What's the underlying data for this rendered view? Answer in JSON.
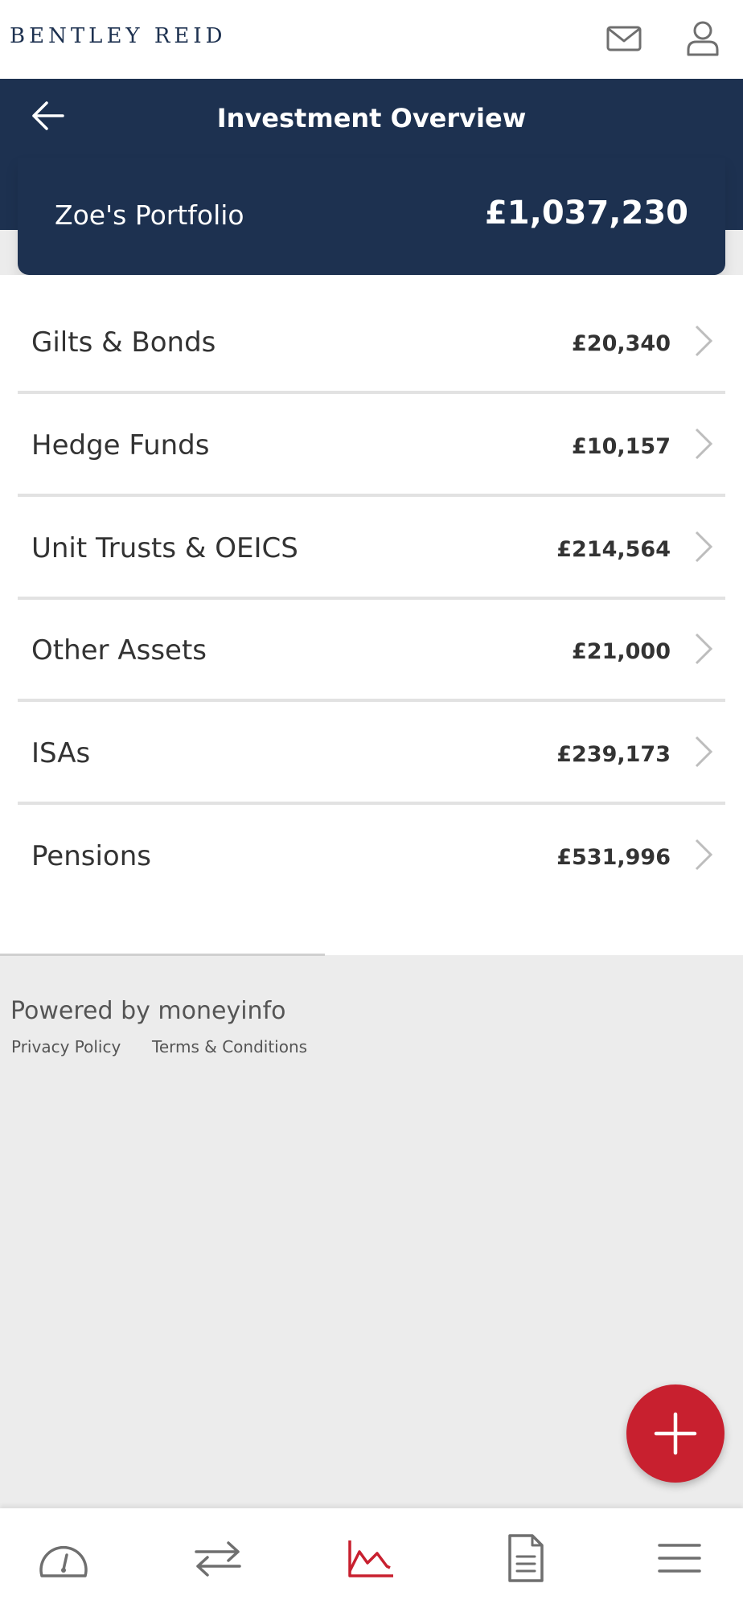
{
  "brand": {
    "name": "BENTLEY REID"
  },
  "header": {
    "title": "Investment Overview"
  },
  "portfolio": {
    "name": "Zoe's Portfolio",
    "total": "£1,037,230"
  },
  "holdings": [
    {
      "label": "Gilts & Bonds",
      "value": "£20,340"
    },
    {
      "label": "Hedge Funds",
      "value": "£10,157"
    },
    {
      "label": "Unit Trusts & OEICS",
      "value": "£214,564"
    },
    {
      "label": "Other Assets",
      "value": "£21,000"
    },
    {
      "label": "ISAs",
      "value": "£239,173"
    },
    {
      "label": "Pensions",
      "value": "£531,996"
    }
  ],
  "footer": {
    "powered_by": "Powered by moneyinfo",
    "privacy": "Privacy Policy",
    "terms": "Terms & Conditions"
  },
  "icons": {
    "top": [
      "mail-icon",
      "user-icon"
    ],
    "nav": [
      "dashboard-gauge-icon",
      "transfer-arrows-icon",
      "investments-chart-icon",
      "document-icon",
      "menu-icon"
    ],
    "fab": "plus-icon",
    "back": "arrow-left-icon",
    "row": "chevron-right-icon"
  },
  "nav": {
    "active": "investments"
  },
  "colors": {
    "brand_navy": "#1d3150",
    "accent_red": "#c8202f",
    "background": "#ececec",
    "icon_gray": "#6f6f6f"
  }
}
